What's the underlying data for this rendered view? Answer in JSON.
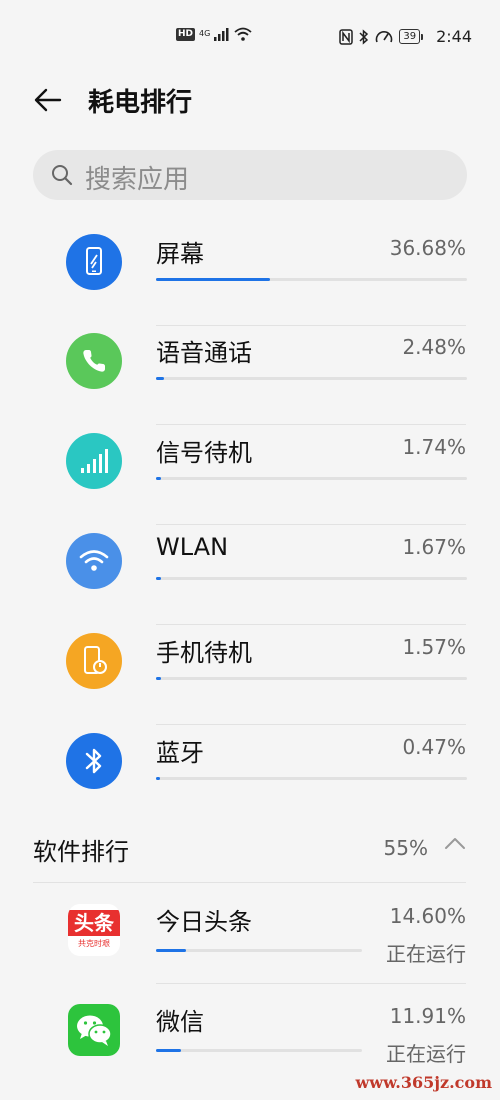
{
  "status_bar": {
    "hd": "HD",
    "network": "4G",
    "battery": "39",
    "time": "2:44"
  },
  "header": {
    "title": "耗电排行"
  },
  "search": {
    "placeholder": "搜索应用"
  },
  "hardware": [
    {
      "name": "屏幕",
      "percent": "36.68%",
      "fraction": 0.3668,
      "icon": "phone-screen-icon",
      "color": "#1f73e6"
    },
    {
      "name": "语音通话",
      "percent": "2.48%",
      "fraction": 0.0248,
      "icon": "phone-call-icon",
      "color": "#5ac85a"
    },
    {
      "name": "信号待机",
      "percent": "1.74%",
      "fraction": 0.0174,
      "icon": "signal-bars-icon",
      "color": "#2ac7c2"
    },
    {
      "name": "WLAN",
      "percent": "1.67%",
      "fraction": 0.0167,
      "icon": "wifi-icon",
      "color": "#4a90e8"
    },
    {
      "name": "手机待机",
      "percent": "1.57%",
      "fraction": 0.0157,
      "icon": "phone-standby-icon",
      "color": "#f5a623"
    },
    {
      "name": "蓝牙",
      "percent": "0.47%",
      "fraction": 0.0047,
      "icon": "bluetooth-icon",
      "color": "#1f73e6"
    }
  ],
  "software_section": {
    "title": "软件排行",
    "percent": "55%"
  },
  "apps": [
    {
      "name": "今日头条",
      "percent": "14.60%",
      "fraction": 0.146,
      "status": "正在运行",
      "icon": "toutiao-logo",
      "icon_text": "头条",
      "icon_subtext": "共克时艰"
    },
    {
      "name": "微信",
      "percent": "11.91%",
      "fraction": 0.1191,
      "status": "正在运行",
      "icon": "wechat-logo"
    }
  ],
  "watermark": "www.365jz.com"
}
